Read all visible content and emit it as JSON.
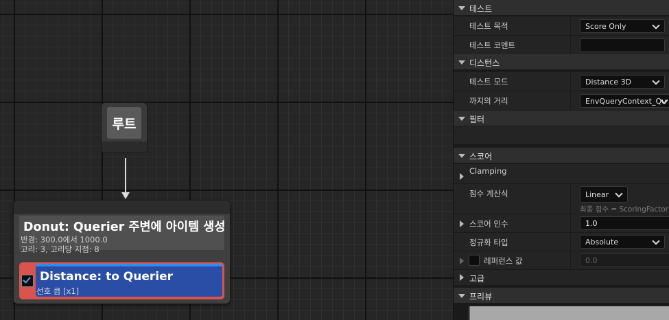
{
  "graph": {
    "root_node": {
      "title": "루트"
    },
    "generator_node": {
      "title": "Donut: Querier 주변에 아이템 생성",
      "desc_line1": "반경: 300.0에서 1000.0",
      "desc_line2": "고리: 3, 고리당 지점: 8"
    },
    "test_node": {
      "enabled": true,
      "title": "Distance: to Querier",
      "subtitle": "선호 큼 [x1]",
      "accent_color": "#d9534f",
      "body_color": "#2a4ea6"
    }
  },
  "details": {
    "sections": {
      "test": "테스트",
      "distance": "디스턴스",
      "filter": "필터",
      "score": "스코어",
      "advanced": "고급",
      "preview": "프리뷰"
    },
    "test_purpose": {
      "label": "테스트 목적",
      "value": "Score Only"
    },
    "test_comment": {
      "label": "테스트 코멘트",
      "value": ""
    },
    "test_mode": {
      "label": "테스트 모드",
      "value": "Distance 3D"
    },
    "distance_to": {
      "label": "까지의 거리",
      "value": "EnvQueryContext_Qu"
    },
    "clamping": {
      "label": "Clamping"
    },
    "score_equation": {
      "label": "점수 계산식",
      "value": "Linear",
      "hint": "최종 점수 = ScoringFactor *"
    },
    "score_factor": {
      "label": "스코어 인수",
      "value": "1.0"
    },
    "normalization": {
      "label": "정규화 타입",
      "value": "Absolute"
    },
    "reference_value": {
      "label": "레퍼런스 값",
      "value": "0.0",
      "enabled": false
    }
  }
}
